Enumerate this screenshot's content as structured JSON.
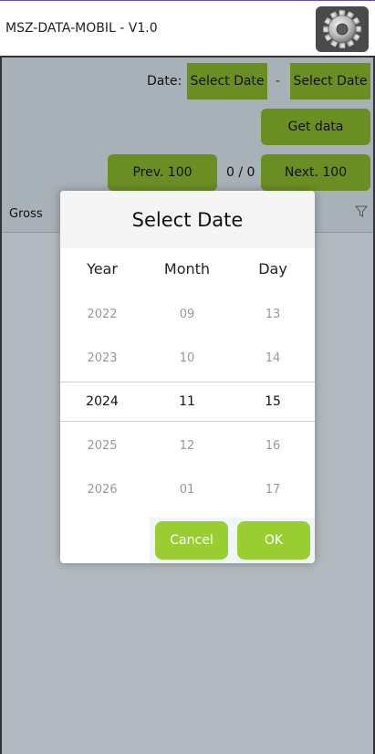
{
  "app": {
    "title": "MSZ-DATA-MOBIL - V1.0",
    "settings_icon": "gear-icon"
  },
  "filters": {
    "date_label": "Date:",
    "start_date": "Select Date",
    "separator": "-",
    "end_date": "Select Date",
    "get_data": "Get data",
    "prev": "Prev. 100",
    "counter": "0 / 0",
    "next": "Next. 100"
  },
  "table": {
    "header": "Gross",
    "filter_icon": "funnel-icon"
  },
  "picker": {
    "title": "Select Date",
    "columns": [
      "Year",
      "Month",
      "Day"
    ],
    "years": [
      "2022",
      "2023",
      "2024",
      "2025",
      "2026"
    ],
    "months": [
      "09",
      "10",
      "11",
      "12",
      "01"
    ],
    "days": [
      "13",
      "14",
      "15",
      "16",
      "17"
    ],
    "selected_index": 2,
    "cancel": "Cancel",
    "ok": "OK"
  },
  "colors": {
    "accent": "#6b8e23",
    "dialog_button": "#9acd32"
  }
}
